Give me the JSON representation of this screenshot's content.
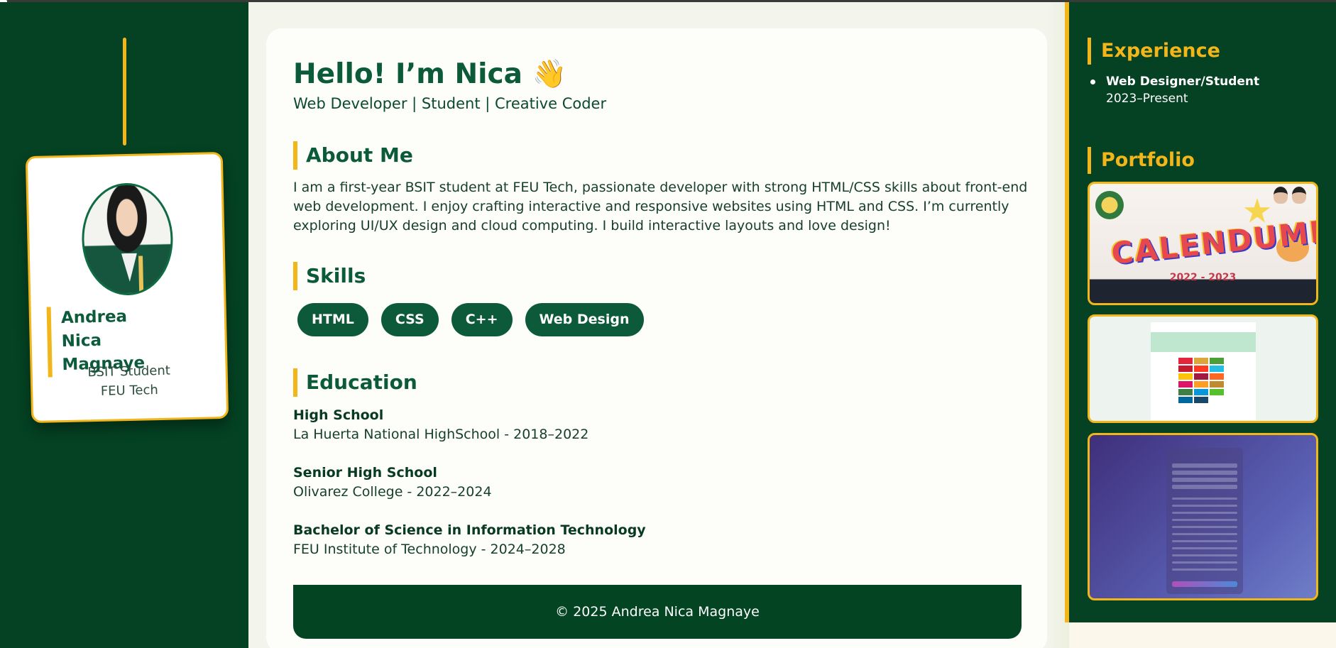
{
  "profile": {
    "name": "Andrea Nica Magnaye",
    "role": "BSIT Student",
    "school": "FEU Tech"
  },
  "header": {
    "greeting": "Hello! I’m Nica",
    "wave": "👋",
    "tagline": "Web Developer | Student | Creative Coder"
  },
  "about": {
    "title": "About Me",
    "text": "I am a first-year BSIT student at FEU Tech, passionate developer with strong HTML/CSS skills about front-end web development. I enjoy crafting interactive and responsive websites using HTML and CSS. I’m currently exploring UI/UX design and cloud computing. I build interactive layouts and love design!"
  },
  "skills": {
    "title": "Skills",
    "items": [
      "HTML",
      "CSS",
      "C++",
      "Web Design"
    ]
  },
  "education": {
    "title": "Education",
    "items": [
      {
        "level": "High School",
        "detail": "La Huerta National HighSchool - 2018–2022"
      },
      {
        "level": "Senior High School",
        "detail": "Olivarez College - 2022–2024"
      },
      {
        "level": "Bachelor of Science in Information Technology",
        "detail": "FEU Institute of Technology - 2024–2028"
      }
    ]
  },
  "footer": {
    "text": "© 2025 Andrea Nica Magnaye"
  },
  "experience": {
    "title": "Experience",
    "items": [
      {
        "role": "Web Designer/Student",
        "dates": "2023–Present"
      }
    ]
  },
  "portfolio": {
    "title": "Portfolio",
    "thumb1": {
      "title": "CALENDUMP",
      "year": "2022 - 2023"
    }
  },
  "colors": {
    "sidebar_green": "#044223",
    "accent_gold": "#f2b51a",
    "heading_green": "#0b5a38"
  }
}
